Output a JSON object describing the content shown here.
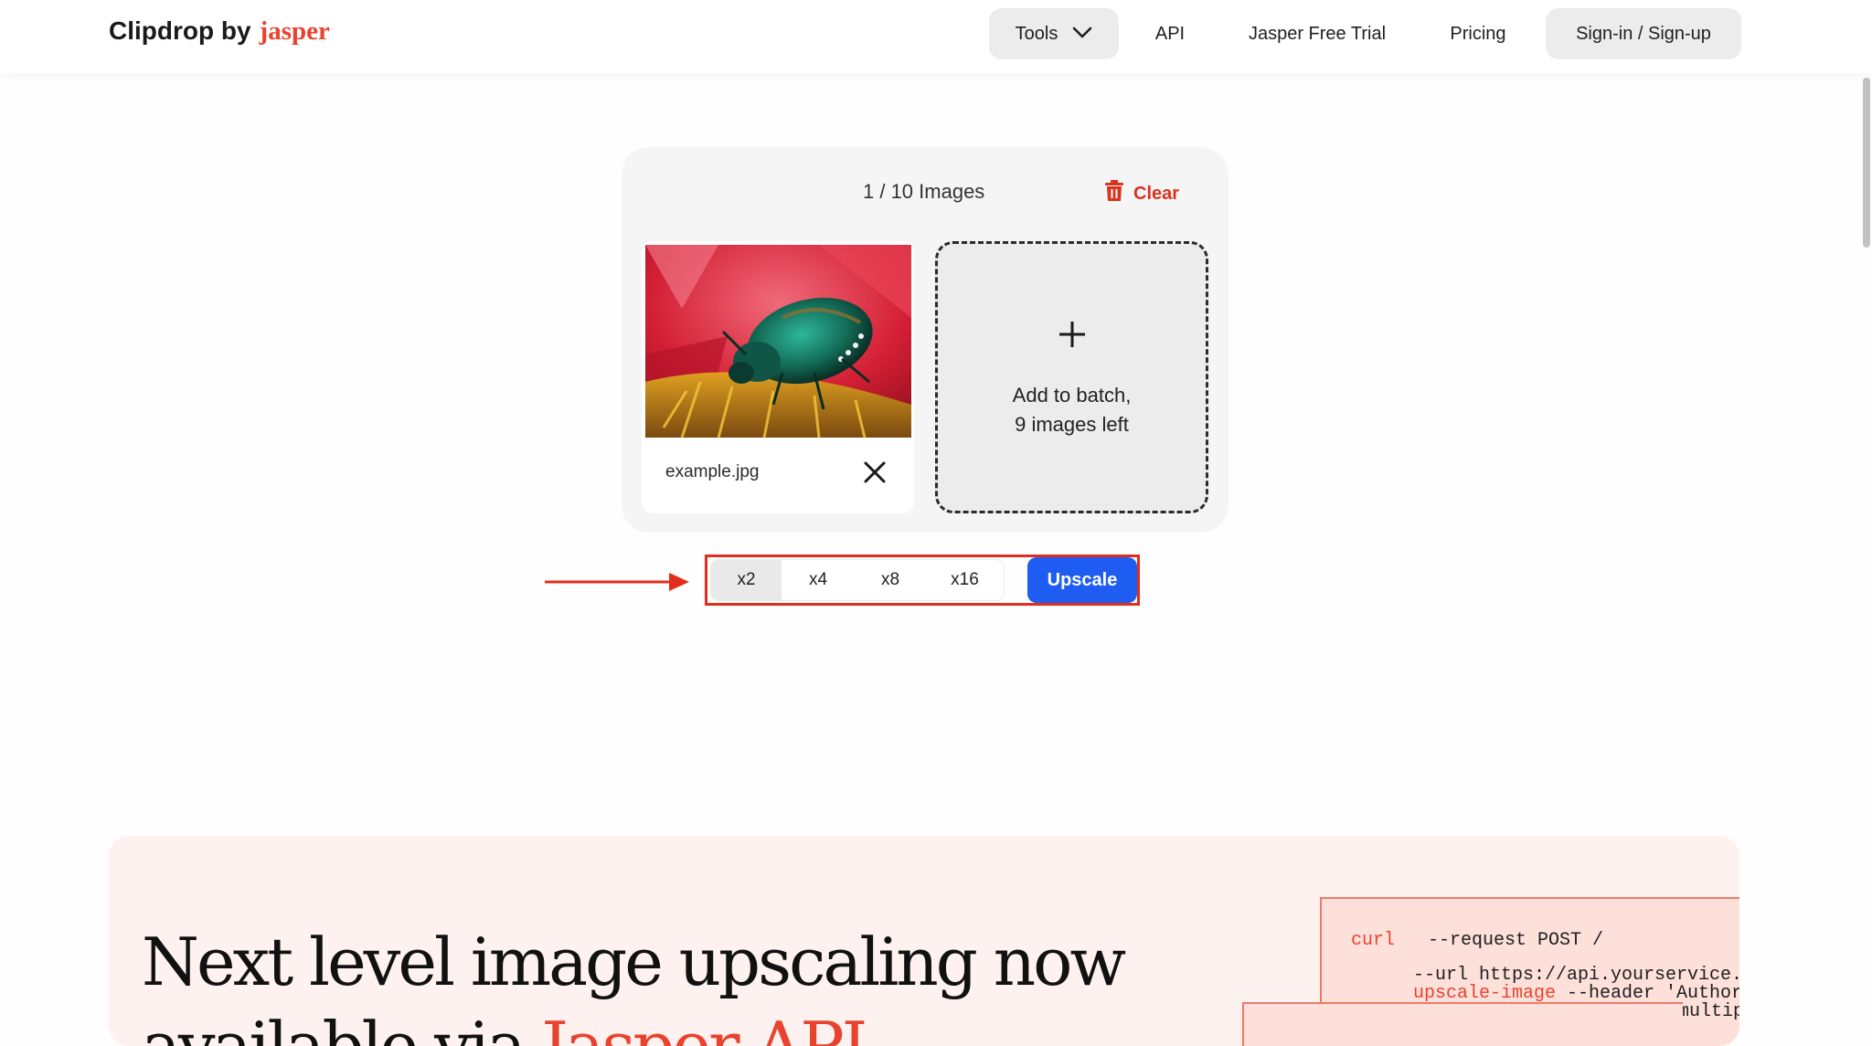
{
  "header": {
    "brand": "Clipdrop by",
    "brand_accent": "jasper",
    "nav": {
      "tools": "Tools",
      "api": "API",
      "trial": "Jasper Free Trial",
      "pricing": "Pricing",
      "signin": "Sign-in / Sign-up"
    }
  },
  "batch": {
    "counter": "1 / 10 Images",
    "clear_label": "Clear",
    "file": {
      "name": "example.jpg"
    },
    "add_line1": "Add to batch,",
    "add_line2": "9 images left"
  },
  "toolbar": {
    "scales": [
      "x2",
      "x4",
      "x8",
      "x16"
    ],
    "selected_scale": "x2",
    "upscale_label": "Upscale"
  },
  "promo": {
    "title_part1": "Next level image upscaling now",
    "title_part2": "available via",
    "title_accent": "Jasper API"
  },
  "code": {
    "line1_kw": "curl",
    "line1_rest": "--request  POST  /",
    "line2": "--url https://api.yourservice.",
    "line3_kw": "upscale-image",
    "line3_rest": " --header 'Author",
    "line4": "multip"
  },
  "colors": {
    "accent_red": "#e8432e",
    "primary_blue": "#1f5cf2",
    "highlight_red": "#e12d1b"
  }
}
